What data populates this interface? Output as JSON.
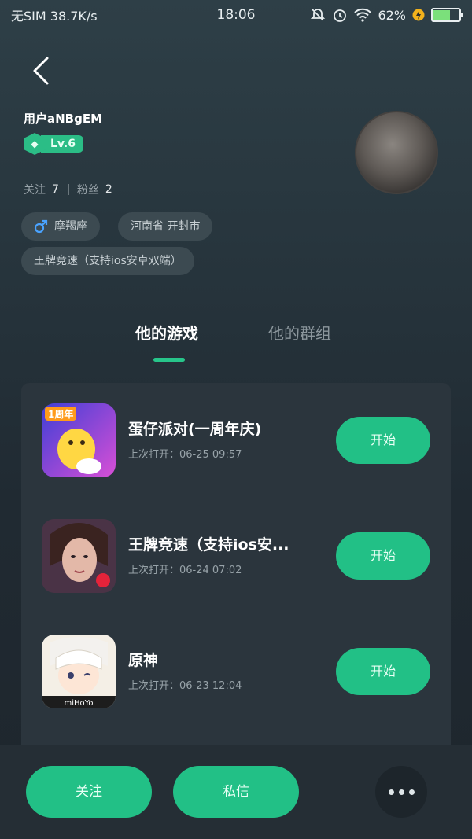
{
  "status_bar": {
    "carrier": "无SIM 38.7K/s",
    "time": "18:06",
    "battery_text": "62%",
    "battery_level": 0.62
  },
  "profile": {
    "username": "用户aNBgEM",
    "level": "Lv.6",
    "following_label": "关注",
    "following_count": "7",
    "fans_label": "粉丝",
    "fans_count": "2",
    "chips": {
      "zodiac": "摩羯座",
      "location": "河南省 开封市",
      "game": "王牌竞速（支持ios安卓双端）"
    }
  },
  "tabs": {
    "games": "他的游戏",
    "groups": "他的群组"
  },
  "games": [
    {
      "name": "蛋仔派对(一周年庆)",
      "last_open": "上次打开：06-25 09:57",
      "button": "开始"
    },
    {
      "name": "王牌竞速（支持ios安...",
      "last_open": "上次打开：06-24 07:02",
      "button": "开始"
    },
    {
      "name": "原神",
      "last_open": "上次打开：06-23 12:04",
      "button": "开始"
    }
  ],
  "game_icon_texts": {
    "icon1": "1周年",
    "icon3": "miHoYo"
  },
  "bottom": {
    "follow_button": "关注",
    "message_button": "私信"
  },
  "colors": {
    "accent": "#22c086",
    "background": "#222c33"
  }
}
